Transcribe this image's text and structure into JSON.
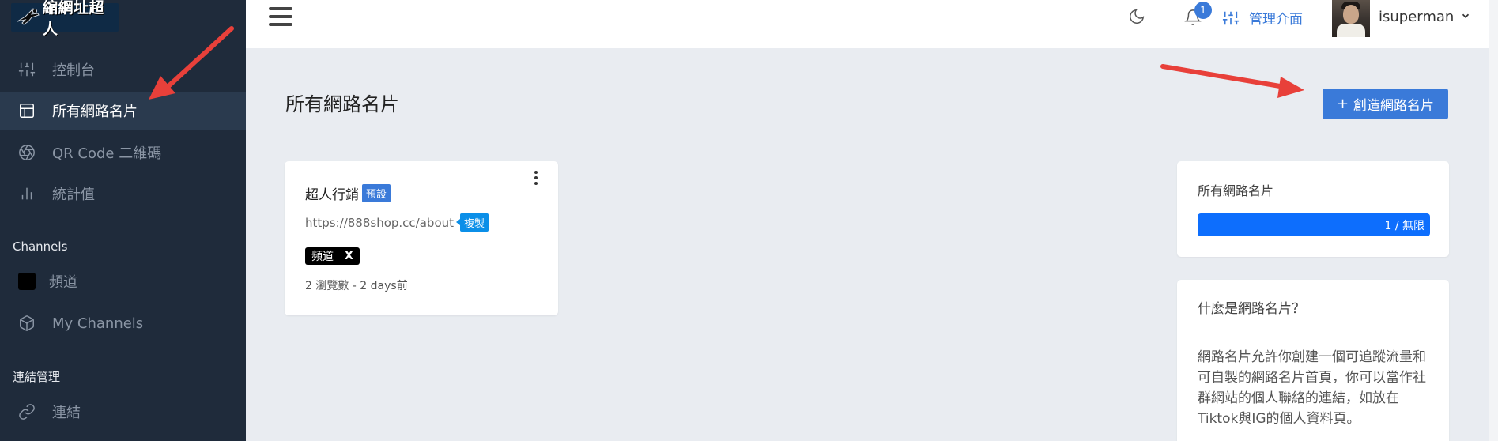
{
  "brand": {
    "logo_text": "縮網址超人"
  },
  "sidebar": {
    "items": [
      {
        "label": "控制台",
        "icon": "sliders-icon"
      },
      {
        "label": "所有網路名片",
        "icon": "layout-icon",
        "active": true
      },
      {
        "label": "QR Code 二維碼",
        "icon": "aperture-icon"
      },
      {
        "label": "統計值",
        "icon": "bar-chart-icon"
      }
    ],
    "channels_title": "Channels",
    "channels": [
      {
        "label": "頻道",
        "icon": "black-square-icon"
      },
      {
        "label": "My Channels",
        "icon": "box-icon"
      }
    ],
    "links_title": "連結管理",
    "links": [
      {
        "label": "連結",
        "icon": "link-icon"
      }
    ]
  },
  "topbar": {
    "notification_count": "1",
    "admin_label": "管理介面",
    "username": "isuperman"
  },
  "main": {
    "title": "所有網路名片",
    "create_button": "創造網路名片",
    "card": {
      "name": "超人行銷",
      "default_tag": "預設",
      "url": "https://888shop.cc/about",
      "copy_tag": "複製",
      "channel": "頻道",
      "channel_remove": "X",
      "meta": "2 瀏覽數 - 2 days前"
    },
    "stats": {
      "title": "所有網路名片",
      "progress_text": "1 / 無限",
      "progress_fraction": 1.0
    },
    "info": {
      "title": "什麼是網路名片？",
      "body": "網路名片允許你創建一個可追蹤流量和可自製的網路名片首頁，你可以當作社群網站的個人聯絡的連結，如放在Tiktok與IG的個人資料頁。"
    }
  },
  "colors": {
    "sidebar_bg": "#1f2b3b",
    "accent": "#3a7ad9",
    "progress": "#0d6efd",
    "annotation_arrow": "#e8403a"
  }
}
